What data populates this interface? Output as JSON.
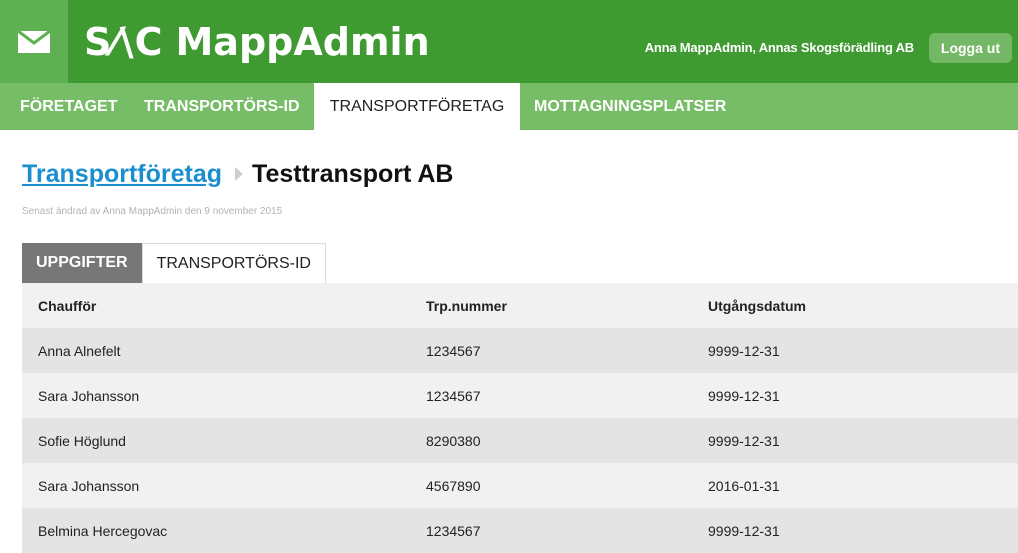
{
  "header": {
    "logo_mark": "S⁄\\C",
    "app_name": "MappAdmin",
    "user_info": "Anna MappAdmin, Annas Skogsförädling AB",
    "logout_label": "Logga ut"
  },
  "nav": {
    "items": [
      "FÖRETAGET",
      "TRANSPORTÖRS-ID",
      "TRANSPORTFÖRETAG",
      "MOTTAGNINGSPLATSER"
    ],
    "active": "TRANSPORTFÖRETAG"
  },
  "breadcrumb": {
    "parent": "Transportföretag",
    "current": "Testtransport AB"
  },
  "meta": "Senast ändrad av Anna MappAdmin den 9 november 2015",
  "tabs": [
    "UPPGIFTER",
    "TRANSPORTÖRS-ID"
  ],
  "table": {
    "columns": [
      "Chaufför",
      "Trp.nummer",
      "Utgångsdatum"
    ],
    "rows": [
      [
        "Anna Alnefelt",
        "1234567",
        "9999-12-31"
      ],
      [
        "Sara Johansson",
        "1234567",
        "9999-12-31"
      ],
      [
        "Sofie Höglund",
        "8290380",
        "9999-12-31"
      ],
      [
        "Sara Johansson",
        "4567890",
        "2016-01-31"
      ],
      [
        "Belmina Hercegovac",
        "1234567",
        "9999-12-31"
      ]
    ]
  },
  "colors": {
    "header_green": "#3f9a32",
    "nav_green": "#77bc67",
    "link_blue": "#1a8fcf",
    "active_tab_gray": "#777777"
  },
  "icons": {
    "mail": "mail-icon",
    "breadcrumb_separator": "chevron-right-icon"
  }
}
